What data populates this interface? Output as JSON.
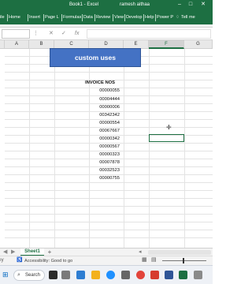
{
  "window": {
    "book_title": "Book1 - Excel",
    "user_name": "ramesh aithaa"
  },
  "ribbon": {
    "tabs": [
      "ile",
      "Home",
      "Insert",
      "Page L",
      "Formulas",
      "Data",
      "Review",
      "View",
      "Develop",
      "Help",
      "Power P"
    ],
    "tell_me": "Tell me"
  },
  "formula_bar": {
    "cancel_symbol": "✕",
    "enter_symbol": "✓",
    "fx_symbol": "fx"
  },
  "columns": [
    "A",
    "B",
    "C",
    "D",
    "E",
    "F",
    "G"
  ],
  "sheet": {
    "title": "custom uses",
    "header": "INVOICE NOS",
    "invoices": [
      "00000055",
      "00004444",
      "00000006",
      "00342342",
      "00000554",
      "00067667",
      "00000342",
      "00000567",
      "00000323",
      "00007878",
      "00032523",
      "00000755"
    ]
  },
  "sheet_tabs": {
    "active": "Sheet1",
    "add_symbol": "+"
  },
  "status": {
    "accessibility": "Accessibility: Good to go"
  },
  "taskbar": {
    "search_label": "Search"
  },
  "colors": {
    "excel_green": "#1d6f42",
    "banner_fill": "#4472c4"
  }
}
